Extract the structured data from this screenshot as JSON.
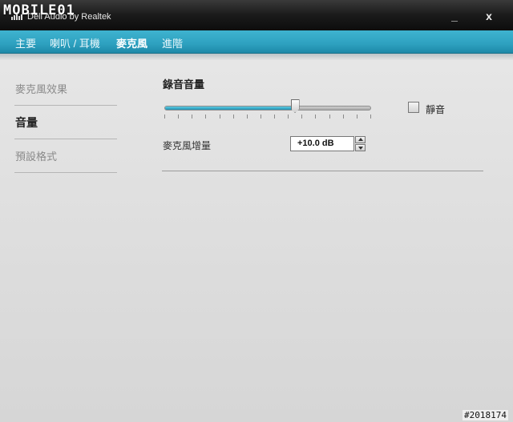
{
  "window": {
    "app_title": "Dell Audio by Realtek",
    "watermark": "MOBILE01",
    "minimize_label": "_",
    "close_label": "x"
  },
  "nav": {
    "tabs": [
      {
        "label": "主要"
      },
      {
        "label": "喇叭 / 耳機"
      },
      {
        "label": "麥克風"
      },
      {
        "label": "進階"
      }
    ],
    "active_tab": "麥克風"
  },
  "sidebar": {
    "items": [
      {
        "label": "麥克風效果"
      },
      {
        "label": "音量"
      },
      {
        "label": "預設格式"
      }
    ],
    "active_item": "音量"
  },
  "main": {
    "section_title": "錄音音量",
    "volume": {
      "level_fraction": 0.63
    },
    "mute": {
      "label": "靜音",
      "checked": false
    },
    "boost": {
      "label": "麥克風增量",
      "value": "+10.0 dB"
    }
  },
  "footer": {
    "post_id": "#2018174"
  },
  "colors": {
    "accent": "#2ea1c0",
    "titlebar": "#1a1a1a",
    "content_bg": "#dcdcdc"
  }
}
